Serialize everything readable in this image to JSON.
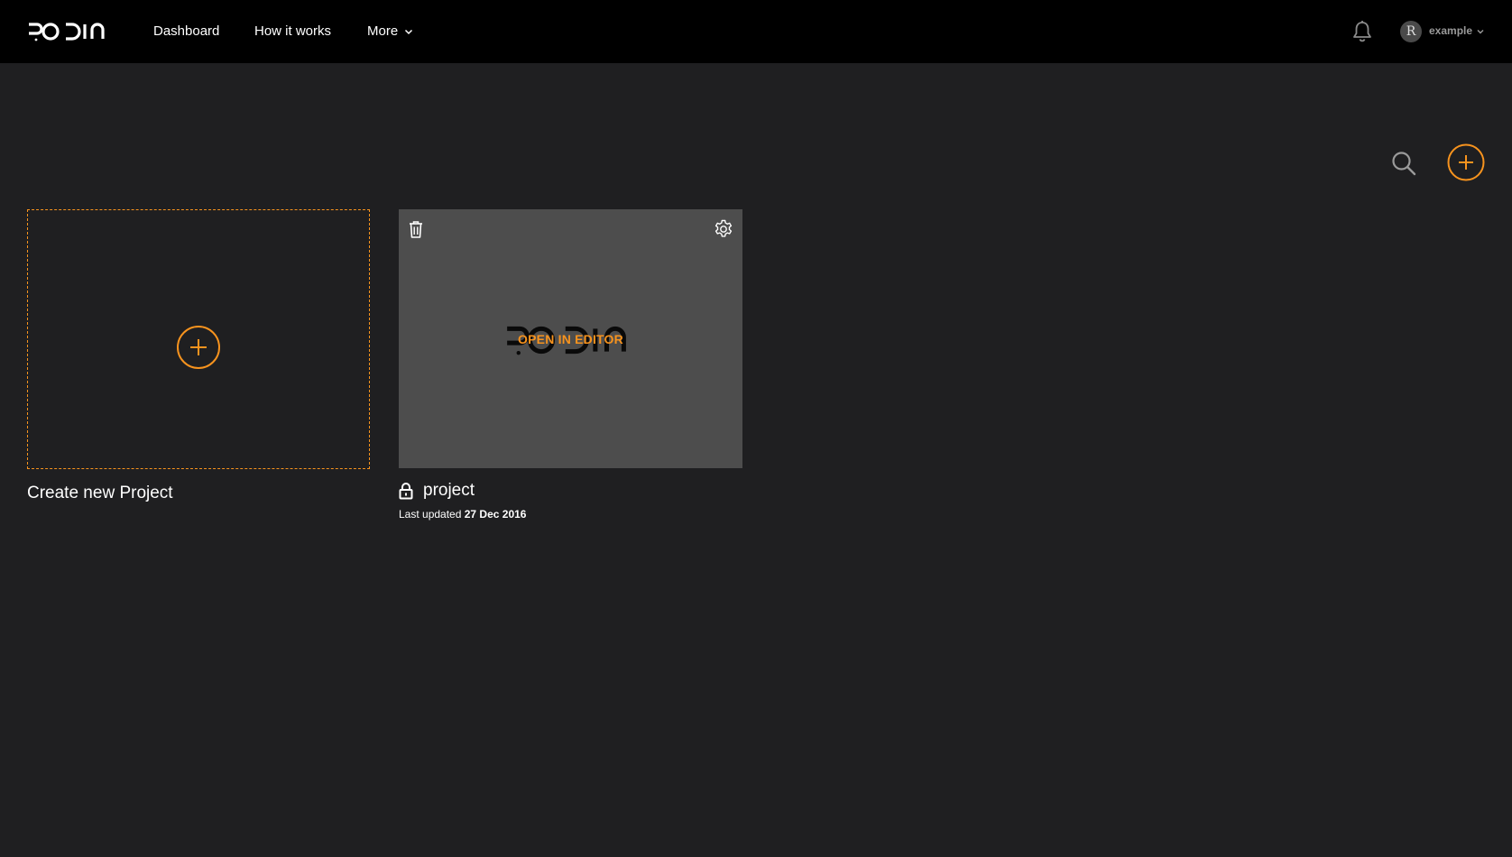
{
  "app": {
    "logo_text": "RODIN",
    "accent_color": "#f7931e",
    "background_color": "#1f1f21",
    "topbar_color": "#000000"
  },
  "nav": {
    "items": [
      {
        "label": "Dashboard"
      },
      {
        "label": "How it works"
      },
      {
        "label": "More"
      }
    ]
  },
  "user": {
    "avatar_initial": "R",
    "username": "example"
  },
  "toolbar": {
    "search_icon": "search-icon",
    "add_icon": "plus-circle-icon"
  },
  "create_card": {
    "label": "Create new Project",
    "icon": "plus-circle-icon"
  },
  "projects": [
    {
      "name": "project",
      "thumbnail_text": "RODIN",
      "overlay_label": "OPEN IN EDITOR",
      "last_updated_label": "Last updated",
      "last_updated_date": "27 Dec 2016",
      "locked": true,
      "icons": [
        "trash-icon",
        "gear-icon",
        "lock-icon"
      ]
    }
  ]
}
